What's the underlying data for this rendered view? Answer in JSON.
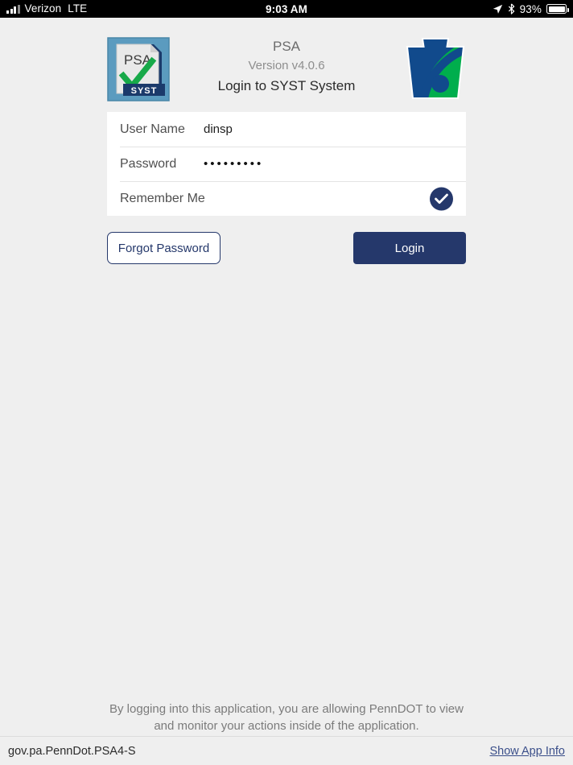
{
  "status_bar": {
    "carrier": "Verizon",
    "network": "LTE",
    "time": "9:03 AM",
    "battery_percent": "93%",
    "icons": [
      "signal-bars-icon",
      "location-arrow-icon",
      "bluetooth-icon",
      "battery-icon"
    ]
  },
  "header": {
    "app_logo": "psa-syst-logo",
    "logo_text_top": "PSA",
    "logo_text_bottom": "SYST",
    "app_name": "PSA",
    "version": "Version v4.0.6",
    "subtitle": "Login to SYST System",
    "agency_logo": "penndot-keystone-logo"
  },
  "form": {
    "username": {
      "label": "User Name",
      "value": "dinsp",
      "placeholder": "User Name"
    },
    "password": {
      "label": "Password",
      "value": "•••••••••",
      "placeholder": "Password"
    },
    "remember_me": {
      "label": "Remember Me",
      "checked": true,
      "icon": "check-icon"
    }
  },
  "actions": {
    "forgot_password": "Forgot Password",
    "login": "Login"
  },
  "disclaimer": {
    "line1": "By logging into this application, you are allowing PennDOT to view",
    "line2": "and monitor your actions inside of the application."
  },
  "bottom_bar": {
    "package": "gov.pa.PennDot.PSA4-S",
    "app_info_link": "Show App Info"
  },
  "colors": {
    "navy": "#25386b",
    "background": "#efefef",
    "card": "#ffffff",
    "keystone_blue": "#114a8c",
    "keystone_green": "#00ae4d",
    "logo_blue": "#5b9bbf",
    "check_green": "#17a949"
  }
}
